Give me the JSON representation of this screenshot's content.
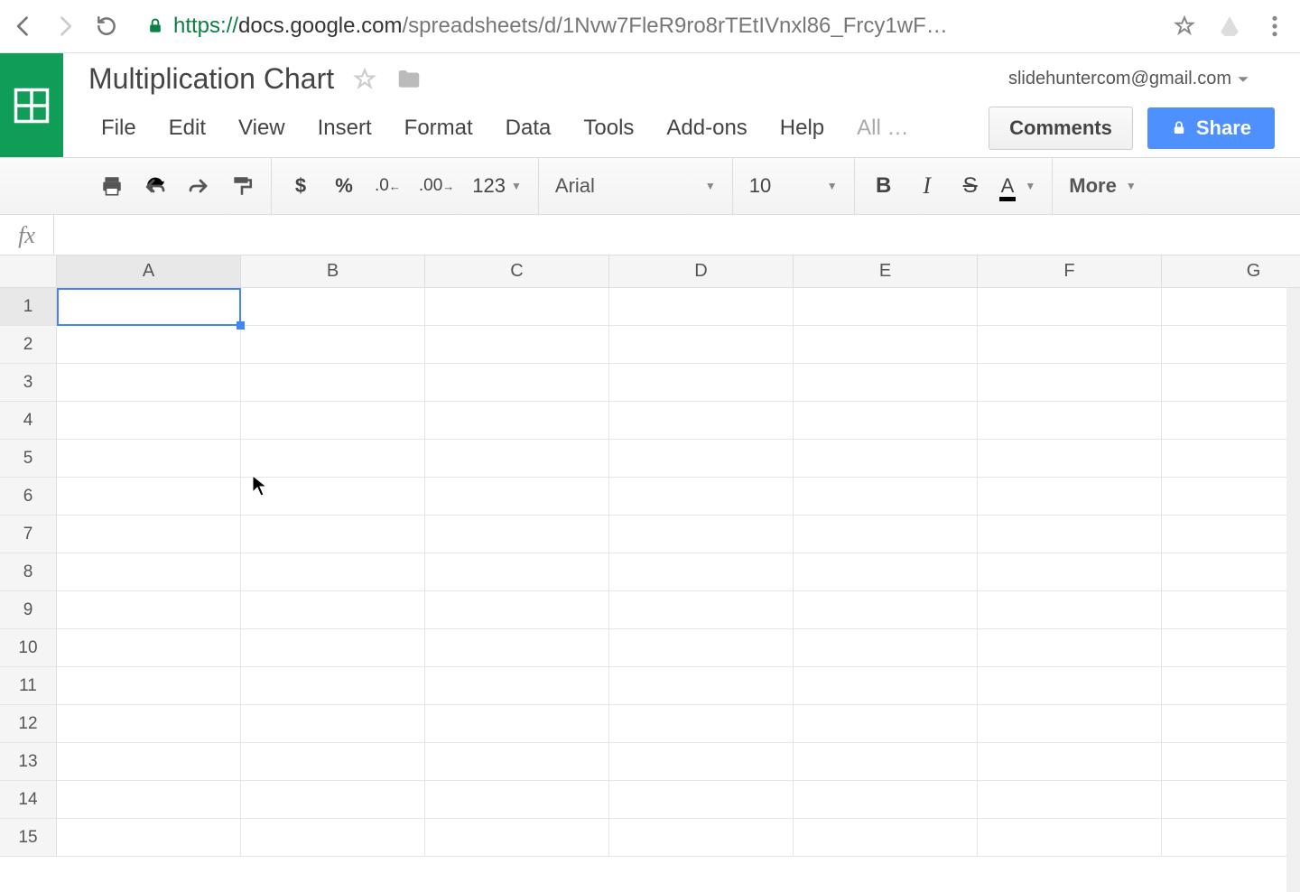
{
  "browser": {
    "url_secure": "https://",
    "url_domain": "docs.google.com",
    "url_path": "/spreadsheets/d/1Nvw7FleR9ro8rTEtIVnxl86_Frcy1wF…"
  },
  "header": {
    "title": "Multiplication Chart",
    "user": "slidehuntercom@gmail.com",
    "comments_label": "Comments",
    "share_label": "Share"
  },
  "menu": {
    "items": [
      "File",
      "Edit",
      "View",
      "Insert",
      "Format",
      "Data",
      "Tools",
      "Add-ons",
      "Help"
    ],
    "more": "All …"
  },
  "toolbar": {
    "currency": "$",
    "percent": "%",
    "dec_dec": ".0",
    "inc_dec": ".00",
    "formats": "123",
    "font": "Arial",
    "fontsize": "10",
    "bold": "B",
    "italic": "I",
    "strike": "S",
    "textcolor": "A",
    "more": "More"
  },
  "formula": {
    "fx": "fx",
    "value": ""
  },
  "grid": {
    "columns": [
      "A",
      "B",
      "C",
      "D",
      "E",
      "F",
      "G"
    ],
    "rows": [
      "1",
      "2",
      "3",
      "4",
      "5",
      "6",
      "7",
      "8",
      "9",
      "10",
      "11",
      "12",
      "13",
      "14",
      "15"
    ],
    "selected_cell": "A1"
  }
}
